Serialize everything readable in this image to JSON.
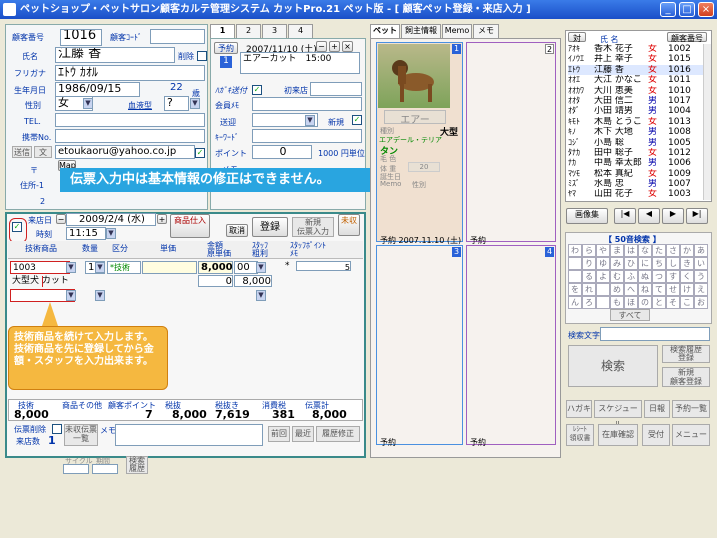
{
  "title": "ペットショップ・ペットサロン顧客カルテ管理システム カットPro.21 ペット版 - [ 顧客ペット登録・来店入力 ]",
  "window_buttons": [
    "_",
    "□",
    "×"
  ],
  "customer": {
    "no_label": "顧客番号",
    "no": "1016",
    "code_label": "顧客ｺｰﾄﾞ",
    "name_label": "氏名",
    "name": "江藤 香",
    "delete_label": "削除",
    "furigana_label": "フリガナ",
    "furigana": "ｴﾄｳ ｶｵﾙ",
    "birth_label": "生年月日",
    "birth": "1986/09/15",
    "age": "22",
    "age_unit": "歳",
    "sex_label": "性別",
    "sex": "女",
    "blood_label": "血液型",
    "blood": "?",
    "tel_label": "TEL.",
    "mobile_label": "携帯No.",
    "email_tabs": [
      "送信",
      "文"
    ],
    "email": "etoukaoru@yahoo.co.jp",
    "zip_label": "〒",
    "map_label": "Map",
    "addr1_label": "住所-1",
    "addr2_label": "2",
    "postcard_label": "ﾊｶﾞｷ送付",
    "first_label": "初来店",
    "memo_label": "会員ﾒﾓ",
    "send_label": "送迎",
    "new_label": "新規",
    "keyword_label": "ｷｰﾜｰﾄﾞ",
    "points_label": "ポイント",
    "points": "0",
    "yen_label": "1000 円単位",
    "memo2_label": "メモ"
  },
  "banner": "伝票入力中は基本情報の修正はできません。",
  "visit_tabs": [
    "1",
    "2",
    "3",
    "4"
  ],
  "reserve": {
    "label": "予約",
    "date": "2007/11/10 (土)",
    "content": "エアーカット　15:00",
    "num": "1"
  },
  "slip": {
    "date_label": "来店日",
    "date": "2009/2/4 (水)",
    "time_label": "時刻",
    "time": "11:15",
    "product_label": "商品仕入",
    "cancel": "取消",
    "register": "登録",
    "new_slip": "新規\n伝票入力",
    "unpaid": "未収",
    "headers": [
      "技術商品",
      "数量",
      "区分",
      "単価",
      "金額\n原単価",
      "ｽﾀｯﾌ\n粗利",
      "ｽﾀｯﾌﾎﾟｲﾝﾄ\nﾒﾓ"
    ],
    "row_code": "1003",
    "row_qty": "1",
    "row_kind": "*技術",
    "row_amount": "8,000",
    "row_staff": "00",
    "row_star": "*",
    "row_pt": "5",
    "row_name": "大型犬 カット",
    "row_cost": "0",
    "row_gross": "8,000"
  },
  "note": "技術商品を続けて入力します。\n技術商品を先に登録してから金額・スタッフを入力出来ます。",
  "totals": {
    "headers": [
      "技術",
      "商品その他",
      "顧客ポイント",
      "税抜",
      "税抜き",
      "消費税",
      "伝票計"
    ],
    "tech": "8,000",
    "pts": "7",
    "subtotal": "8,000",
    "taxex": "7,619",
    "tax": "381",
    "total": "8,000"
  },
  "footer": {
    "slip_delete": "伝票削除",
    "visits_label": "来店数",
    "visits": "1",
    "unpaid_list": "未収伝票\n一覧",
    "memo": "メモ",
    "prev": "前回",
    "recent": "最近",
    "history_fix": "履歴修正"
  },
  "bottom": {
    "cycle": "サイクル",
    "interval": "期間",
    "search": "検索\n履歴"
  },
  "pet_tabs": [
    "ペット",
    "飼主情報",
    "Memo",
    "メモ"
  ],
  "pet": {
    "name": "エアー",
    "size": "大型",
    "breed": "エアデール・テリア",
    "color": "タン",
    "kind_label": "種別",
    "size_label": "大型",
    "color_label": "毛 色",
    "weight_label": "体 重",
    "weight": "20",
    "birth_label": "誕生日",
    "memo_label": "Memo",
    "sex_label": "性別",
    "reserve": "予約 2007.11.10 (土)"
  },
  "slots": [
    "1",
    "2",
    "3",
    "4"
  ],
  "customer_list": {
    "header": [
      "対",
      "氏 名",
      "顧客番号"
    ],
    "rows": [
      [
        "ｱｵｷ",
        "香木 花子",
        "女",
        "1002"
      ],
      [
        "ｲﾉｳｴ",
        "井上 幸子",
        "女",
        "1015"
      ],
      [
        "ｴﾄｳ",
        "江藤 香",
        "女",
        "1016"
      ],
      [
        "ｵｵｴ",
        "大江 かなこ",
        "女",
        "1011"
      ],
      [
        "ｵｵｶﾜ",
        "大川 恵美",
        "女",
        "1010"
      ],
      [
        "ｵｵﾀ",
        "大田 信二",
        "男",
        "1017"
      ],
      [
        "ｵﾀﾞ",
        "小田 靖男",
        "男",
        "1004"
      ],
      [
        "ｷﾓﾄ",
        "木島 とうこ",
        "女",
        "1013"
      ],
      [
        "ｷﾉ",
        "木下 大地",
        "男",
        "1008"
      ],
      [
        "ｺｼﾞ",
        "小島 聡",
        "男",
        "1005"
      ],
      [
        "ﾀﾅｶ",
        "田中 聡子",
        "女",
        "1012"
      ],
      [
        "ﾅｶ",
        "中島 幸太郎",
        "男",
        "1006"
      ],
      [
        "ﾏﾂﾓ",
        "松本 真紀",
        "女",
        "1009"
      ],
      [
        "ﾐｽﾞ",
        "水島 忠",
        "男",
        "1007"
      ],
      [
        "ﾔﾏ",
        "山田 花子",
        "女",
        "1003"
      ]
    ]
  },
  "nav": {
    "image_label": "画像集",
    "btns": [
      "|◀",
      "◀",
      "▶",
      "▶|"
    ]
  },
  "kana_title": "【 50音検索 】",
  "kana_rows": [
    [
      "わ",
      "ら",
      "や",
      "ま",
      "は",
      "な",
      "た",
      "さ",
      "か",
      "あ"
    ],
    [
      "",
      "り",
      "ゆ",
      "み",
      "ひ",
      "に",
      "ち",
      "し",
      "き",
      "い"
    ],
    [
      "",
      "る",
      "よ",
      "む",
      "ふ",
      "ぬ",
      "つ",
      "す",
      "く",
      "う"
    ],
    [
      "を",
      "れ",
      "",
      "め",
      "へ",
      "ね",
      "て",
      "せ",
      "け",
      "え"
    ],
    [
      "ん",
      "ろ",
      "",
      "も",
      "ほ",
      "の",
      "と",
      "そ",
      "こ",
      "お"
    ]
  ],
  "kana_all": "すべて",
  "search": {
    "label": "検索文字",
    "search_btn": "検索",
    "history": "検索履歴\n登録",
    "new_cust": "新規\n顧客登録"
  },
  "bottom_btns": {
    "hagaki": "ハガキ",
    "schedule": "スケジュール",
    "daily": "日報",
    "reserve_list": "予約一覧",
    "receipt": "ﾚｼｰﾄ\n領収書",
    "stock": "在庫確認",
    "accept": "受付",
    "menu": "メニュー"
  },
  "colors": {
    "titlebar": "#2a62d8",
    "banner": "#29a5e0",
    "note": "#f5b840",
    "grn": "#008800"
  }
}
